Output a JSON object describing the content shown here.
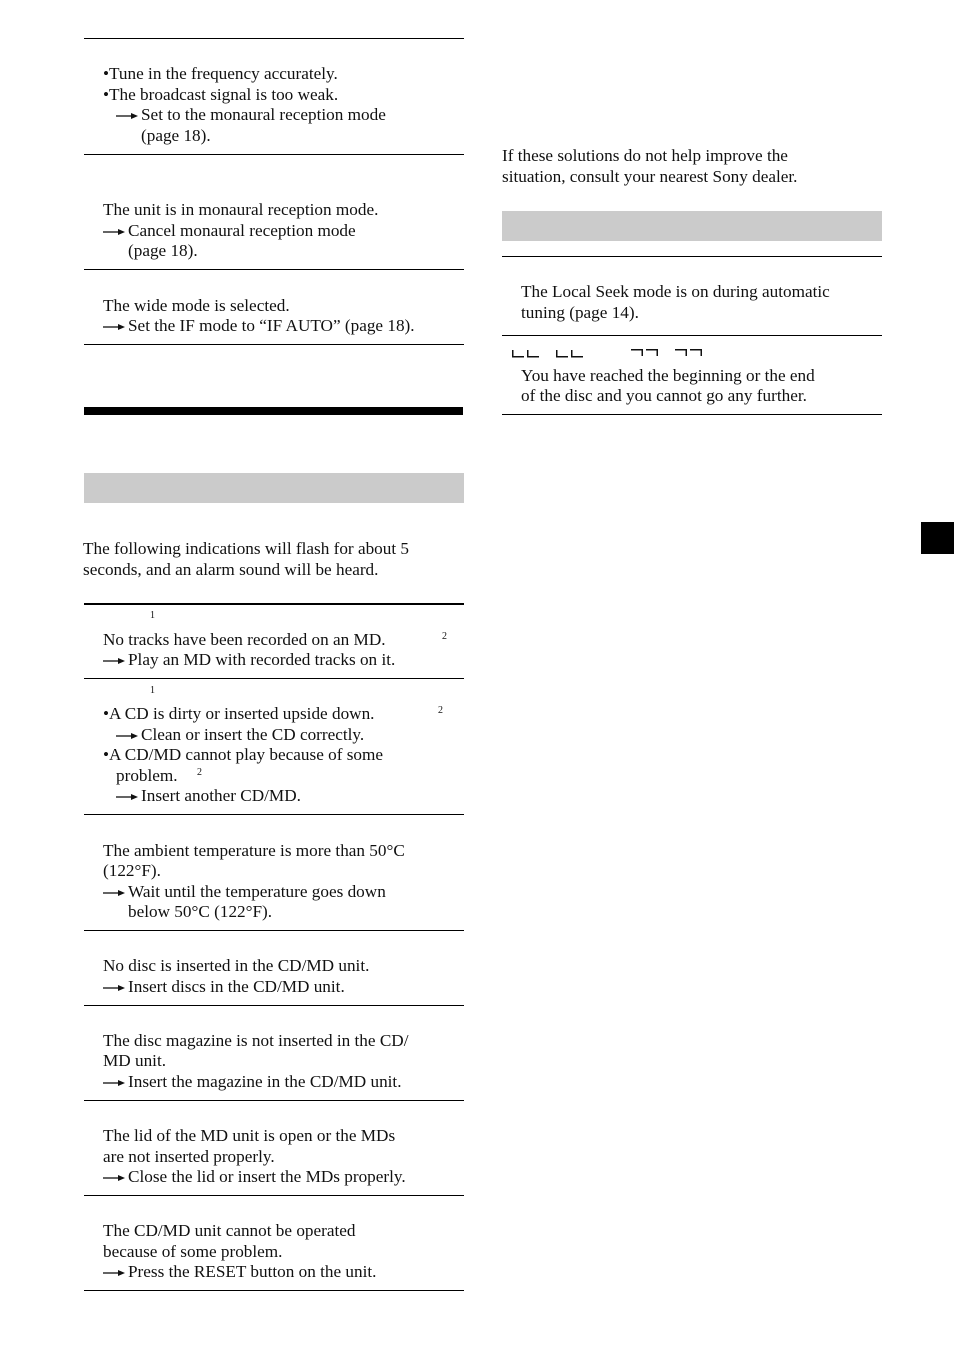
{
  "left_column": {
    "fm_section": [
      {
        "lines": [
          {
            "type": "bullet",
            "text": "Tune in the frequency accurately."
          },
          {
            "type": "bullet",
            "text": "The broadcast signal is too weak."
          },
          {
            "type": "arrow",
            "text": "Set to the monaural reception mode"
          },
          {
            "type": "cont",
            "text": "(page 18)."
          }
        ]
      },
      {
        "lines": [
          {
            "type": "plain",
            "text": "The unit is in monaural reception mode."
          },
          {
            "type": "arrow",
            "text": "Cancel monaural reception mode"
          },
          {
            "type": "cont",
            "text": "(page 18)."
          }
        ]
      },
      {
        "lines": [
          {
            "type": "plain",
            "text": "The wide mode is selected."
          },
          {
            "type": "arrow",
            "text": "Set the IF mode to “IF AUTO” (page 18)."
          }
        ]
      }
    ],
    "intro": [
      "The following indications will flash for about 5",
      "seconds, and an alarm sound will be heard."
    ],
    "indications": [
      {
        "footnote": "1",
        "lines": [
          {
            "type": "plain",
            "text": "No tracks have been recorded on an MD.",
            "sup": "2"
          },
          {
            "type": "arrow",
            "text": "Play an MD with recorded tracks on it."
          }
        ]
      },
      {
        "footnote": "1",
        "lines": [
          {
            "type": "bullet",
            "text": "A CD is dirty or inserted upside down.",
            "sup": "2"
          },
          {
            "type": "arrow-indent",
            "text": "Clean or insert the CD correctly."
          },
          {
            "type": "bullet",
            "text": "A CD/MD cannot play because of some"
          },
          {
            "type": "bullet-cont",
            "text": "problem.",
            "sup": "2"
          },
          {
            "type": "arrow-indent",
            "text": "Insert another CD/MD."
          }
        ]
      },
      {
        "lines": [
          {
            "type": "plain",
            "text": "The ambient temperature is more than 50°C"
          },
          {
            "type": "plain",
            "text": "(122°F)."
          },
          {
            "type": "arrow",
            "text": "Wait until the temperature goes down"
          },
          {
            "type": "cont",
            "text": "below 50°C (122°F)."
          }
        ]
      },
      {
        "lines": [
          {
            "type": "plain",
            "text": "No disc is inserted in the CD/MD unit."
          },
          {
            "type": "arrow",
            "text": "Insert discs in the CD/MD unit."
          }
        ]
      },
      {
        "lines": [
          {
            "type": "plain",
            "text": "The disc magazine is not inserted in the CD/"
          },
          {
            "type": "plain",
            "text": "MD unit."
          },
          {
            "type": "arrow",
            "text": "Insert the magazine in the CD/MD unit."
          }
        ]
      },
      {
        "lines": [
          {
            "type": "plain",
            "text": "The lid of the MD unit is open or the MDs"
          },
          {
            "type": "plain",
            "text": "are not inserted properly."
          },
          {
            "type": "arrow",
            "text": "Close the lid or insert the MDs properly."
          }
        ]
      },
      {
        "lines": [
          {
            "type": "plain",
            "text": "The CD/MD unit cannot be operated"
          },
          {
            "type": "plain",
            "text": "because of some problem."
          },
          {
            "type": "arrow",
            "text": "Press the RESET button on the unit."
          }
        ]
      }
    ]
  },
  "right_column": {
    "consult": [
      "If these solutions do not help improve the",
      "situation, consult your nearest Sony dealer."
    ],
    "messages": [
      {
        "lines": [
          "The Local Seek mode is on during automatic",
          "tuning (page 14)."
        ]
      },
      {
        "display_icons": [
          "lcd-begin-icon",
          "lcd-begin-icon",
          "lcd-end-icon",
          "lcd-end-icon"
        ],
        "lines": [
          "You have reached the beginning or the end",
          "of the disc and you cannot go any further."
        ]
      }
    ]
  }
}
